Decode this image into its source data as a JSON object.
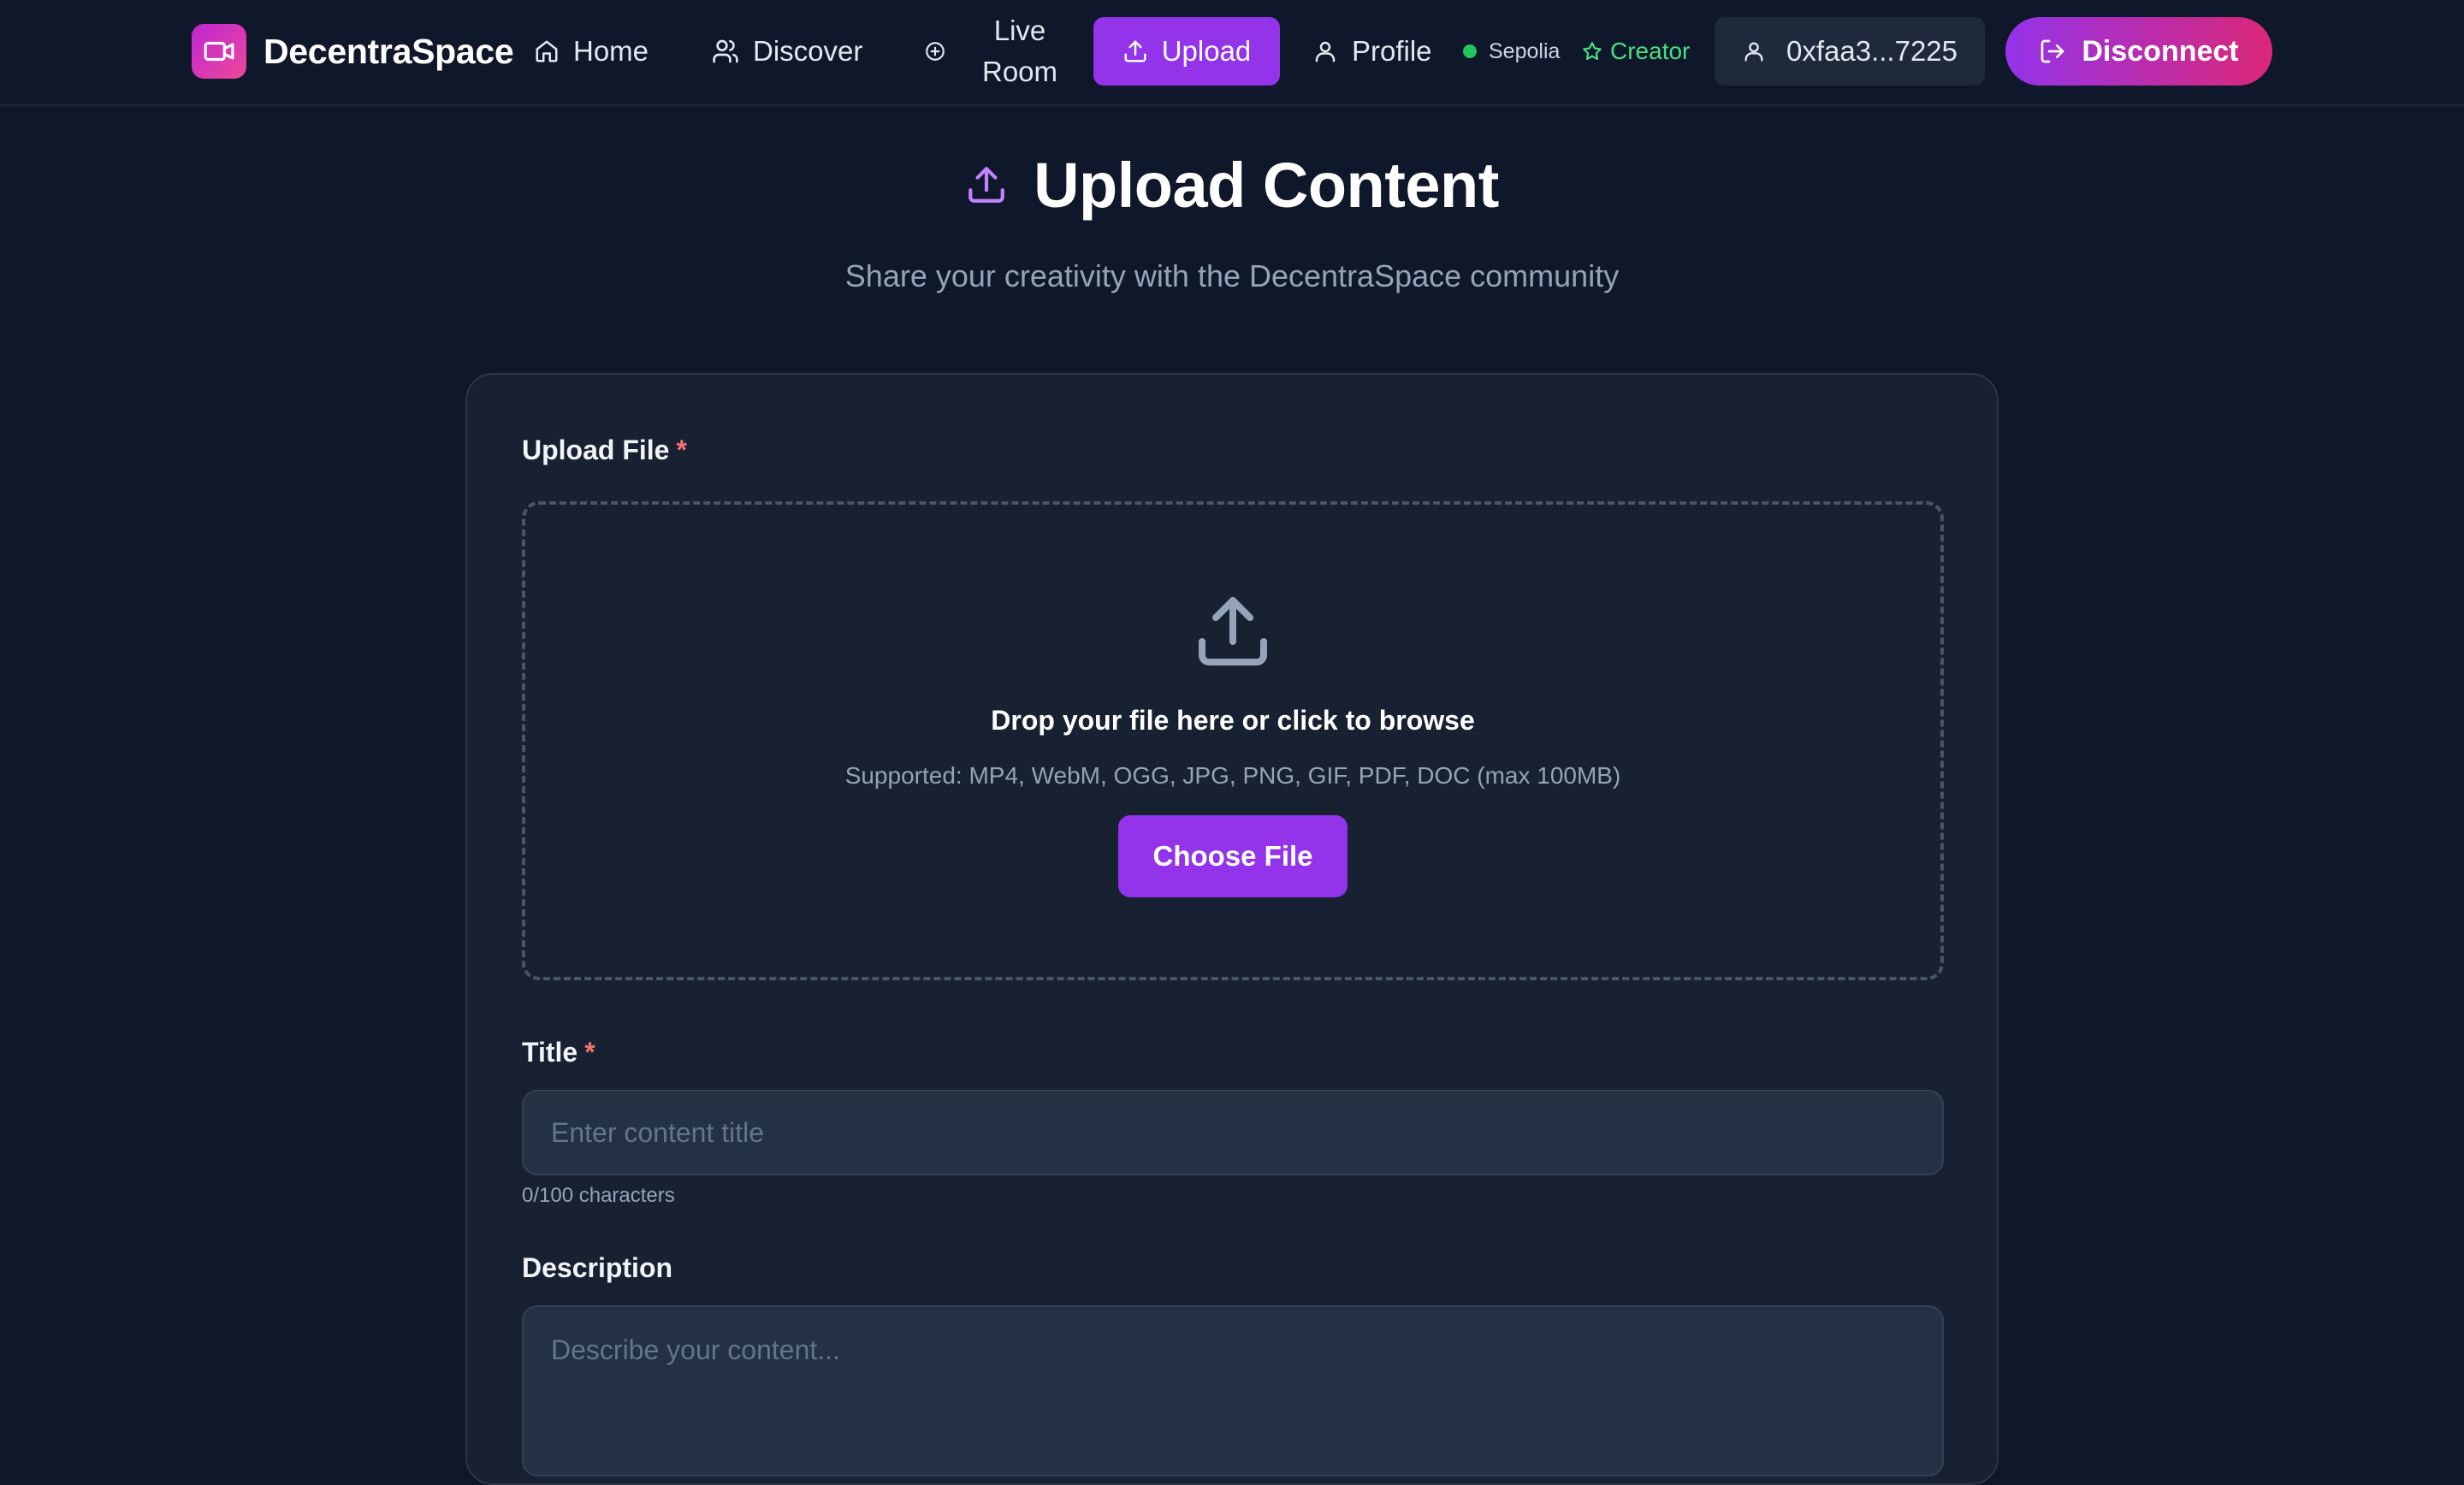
{
  "app": {
    "brand": "DecentraSpace"
  },
  "nav": {
    "home": "Home",
    "discover": "Discover",
    "live_line1": "Live",
    "live_line2": "Room",
    "upload": "Upload",
    "profile": "Profile",
    "network": "Sepolia",
    "role": "Creator",
    "wallet": "0xfaa3...7225",
    "disconnect": "Disconnect"
  },
  "header": {
    "title": "Upload Content",
    "subtitle": "Share your creativity with the DecentraSpace community"
  },
  "form": {
    "file_label": "Upload File",
    "required_mark": "*",
    "drop_text": "Drop your file here or click to browse",
    "drop_supported": "Supported: MP4, WebM, OGG, JPG, PNG, GIF, PDF, DOC (max 100MB)",
    "choose_file": "Choose File",
    "title_label": "Title",
    "title_placeholder": "Enter content title",
    "title_counter": "0/100 characters",
    "description_label": "Description",
    "description_placeholder": "Describe your content..."
  },
  "icons": {
    "brand": "video-camera-icon",
    "home": "home-icon",
    "discover": "users-icon",
    "live": "plus-circle-icon",
    "upload": "upload-icon",
    "profile": "user-icon",
    "creator": "star-icon",
    "wallet": "user-icon",
    "disconnect": "logout-icon"
  },
  "colors": {
    "background": "#0f172a",
    "card": "#182132",
    "accent": "#9333ea",
    "accent_pink": "#db2777",
    "success": "#22c55e",
    "required": "#f87171"
  }
}
